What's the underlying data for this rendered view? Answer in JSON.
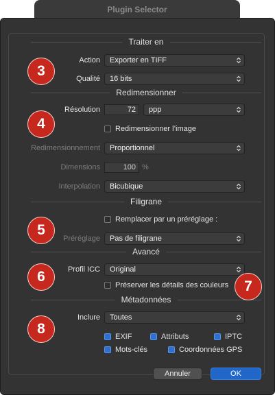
{
  "window": {
    "title": "Plugin Selector"
  },
  "sections": {
    "traiter": "Traiter en",
    "redim": "Redimensionner",
    "filigrane": "Filigrane",
    "avance": "Avancé",
    "meta": "Métadonnées"
  },
  "traiter": {
    "action_label": "Action",
    "action_value": "Exporter en TIFF",
    "qualite_label": "Qualité",
    "qualite_value": "16 bits"
  },
  "redim": {
    "resolution_label": "Résolution",
    "resolution_value": "72",
    "resolution_unit": "ppp",
    "resize_checkbox": "Redimensionner l’image",
    "resize_checked": false,
    "mode_label": "Redimensionnement",
    "mode_value": "Proportionnel",
    "dimensions_label": "Dimensions",
    "dimensions_value": "100",
    "dimensions_unit": "%",
    "interp_label": "Interpolation",
    "interp_value": "Bicubique"
  },
  "filigrane": {
    "replace_checkbox": "Remplacer par un préréglage :",
    "replace_checked": false,
    "preset_label": "Préréglage",
    "preset_value": "Pas de filigrane"
  },
  "avance": {
    "icc_label": "Profil ICC",
    "icc_value": "Original",
    "preserve_checkbox": "Préserver les détails des couleurs",
    "preserve_checked": false
  },
  "meta": {
    "include_label": "Inclure",
    "include_value": "Toutes",
    "exif": "EXIF",
    "attributs": "Attributs",
    "iptc": "IPTC",
    "motscles": "Mots-clés",
    "gps": "Coordonnées GPS"
  },
  "badges": [
    "3",
    "4",
    "5",
    "6",
    "7",
    "8"
  ],
  "buttons": {
    "cancel": "Annuler",
    "ok": "OK"
  },
  "colors": {
    "dialog_bg": "#333333",
    "badge_red": "#c7281e",
    "accent_blue": "#2167c8"
  },
  "icons": {
    "chevron": "up-down-chevron-icon",
    "check": "checkmark-icon"
  }
}
